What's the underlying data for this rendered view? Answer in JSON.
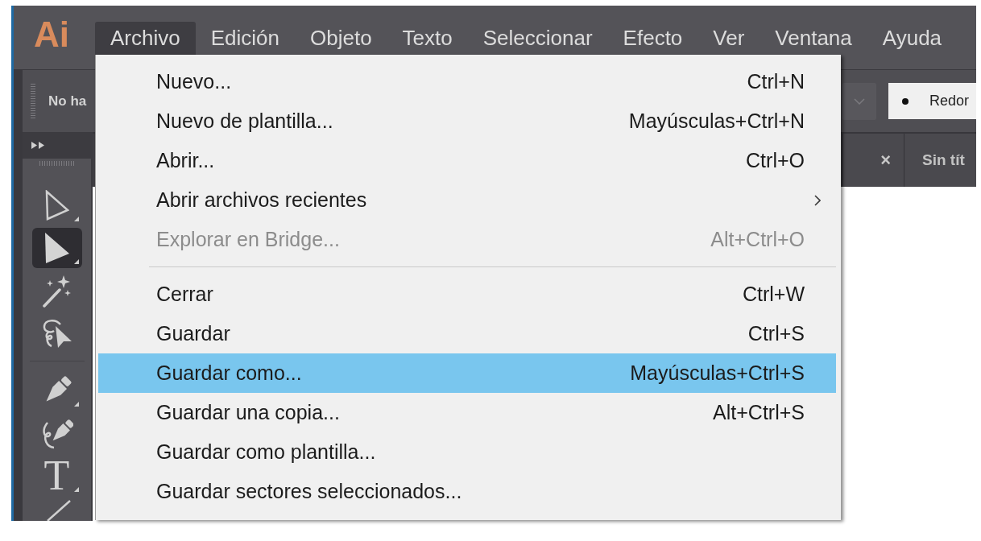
{
  "app_logo": "Ai",
  "menubar": [
    {
      "label": "Archivo",
      "selected": true
    },
    {
      "label": "Edición",
      "selected": false
    },
    {
      "label": "Objeto",
      "selected": false
    },
    {
      "label": "Texto",
      "selected": false
    },
    {
      "label": "Seleccionar",
      "selected": false
    },
    {
      "label": "Efecto",
      "selected": false
    },
    {
      "label": "Ver",
      "selected": false
    },
    {
      "label": "Ventana",
      "selected": false
    },
    {
      "label": "Ayuda",
      "selected": false
    }
  ],
  "control_bar": {
    "selection_label": "No ha",
    "brush_field": {
      "value": "Redor"
    }
  },
  "toolbar": {
    "groups": [
      {
        "tools": [
          {
            "kind": "selection",
            "selected": false,
            "flyout": true
          },
          {
            "kind": "direct",
            "selected": true,
            "flyout": true
          },
          {
            "kind": "wand",
            "selected": false,
            "flyout": false
          },
          {
            "kind": "lasso",
            "selected": false,
            "flyout": false
          }
        ]
      },
      {
        "tools": [
          {
            "kind": "pen",
            "selected": false,
            "flyout": true
          },
          {
            "kind": "curvature",
            "selected": false,
            "flyout": false
          },
          {
            "kind": "type",
            "glyph": "T",
            "selected": false,
            "flyout": true
          },
          {
            "kind": "line",
            "selected": false,
            "flyout": false
          }
        ]
      }
    ]
  },
  "document_tabs": [
    {
      "close": "×"
    },
    {
      "label": "Sin tít"
    }
  ],
  "file_menu": {
    "items": [
      {
        "kind": "item",
        "label": "Nuevo...",
        "shortcut": "Ctrl+N",
        "disabled": false,
        "selected": false,
        "submenu": false
      },
      {
        "kind": "item",
        "label": "Nuevo de plantilla...",
        "shortcut": "Mayúsculas+Ctrl+N",
        "disabled": false,
        "selected": false,
        "submenu": false
      },
      {
        "kind": "item",
        "label": "Abrir...",
        "shortcut": "Ctrl+O",
        "disabled": false,
        "selected": false,
        "submenu": false
      },
      {
        "kind": "item",
        "label": "Abrir archivos recientes",
        "disabled": false,
        "selected": false,
        "submenu": true
      },
      {
        "kind": "item",
        "label": "Explorar en Bridge...",
        "shortcut": "Alt+Ctrl+O",
        "disabled": true,
        "selected": false,
        "submenu": false
      },
      {
        "kind": "separator"
      },
      {
        "kind": "item",
        "label": "Cerrar",
        "shortcut": "Ctrl+W",
        "disabled": false,
        "selected": false,
        "submenu": false
      },
      {
        "kind": "item",
        "label": "Guardar",
        "shortcut": "Ctrl+S",
        "disabled": false,
        "selected": false,
        "submenu": false
      },
      {
        "kind": "item",
        "label": "Guardar como...",
        "shortcut": "Mayúsculas+Ctrl+S",
        "disabled": false,
        "selected": true,
        "submenu": false
      },
      {
        "kind": "item",
        "label": "Guardar una copia...",
        "shortcut": "Alt+Ctrl+S",
        "disabled": false,
        "selected": false,
        "submenu": false
      },
      {
        "kind": "item",
        "label": "Guardar como plantilla...",
        "disabled": false,
        "selected": false,
        "submenu": false
      },
      {
        "kind": "item",
        "label": "Guardar sectores seleccionados...",
        "disabled": false,
        "selected": false,
        "submenu": false
      }
    ]
  }
}
